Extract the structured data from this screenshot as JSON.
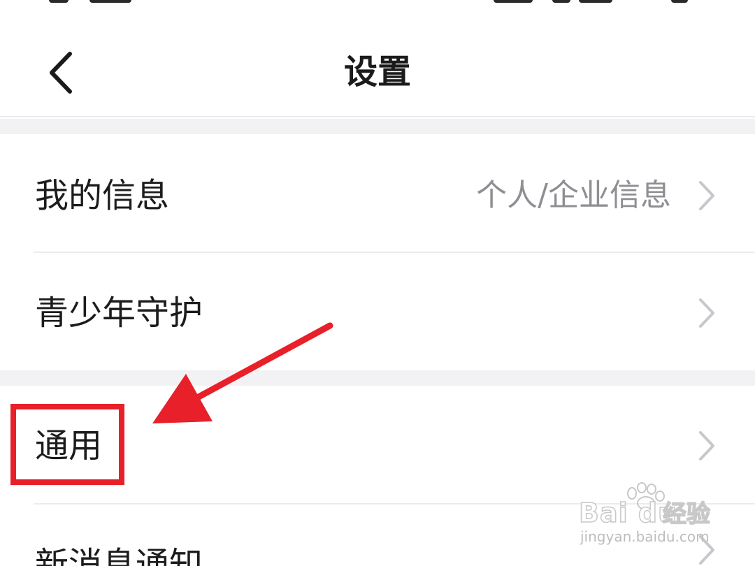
{
  "header": {
    "title": "设置",
    "back_icon": "chevron-left-icon"
  },
  "settings": {
    "my_info": {
      "label": "我的信息",
      "value": "个人/企业信息"
    },
    "teen_guard": {
      "label": "青少年守护"
    },
    "general": {
      "label": "通用"
    },
    "notifications": {
      "label": "新消息通知"
    }
  },
  "annotation": {
    "color": "#e8202a"
  },
  "watermark": {
    "brand": "Bai du",
    "cn": "经验",
    "url": "jingyan.baidu.com"
  },
  "colors": {
    "background": "#ffffff",
    "section_gap": "#f2f2f5",
    "primary_text": "#1c1c1c",
    "secondary_text": "#8e8e93",
    "chevron": "#c7c7cc"
  }
}
